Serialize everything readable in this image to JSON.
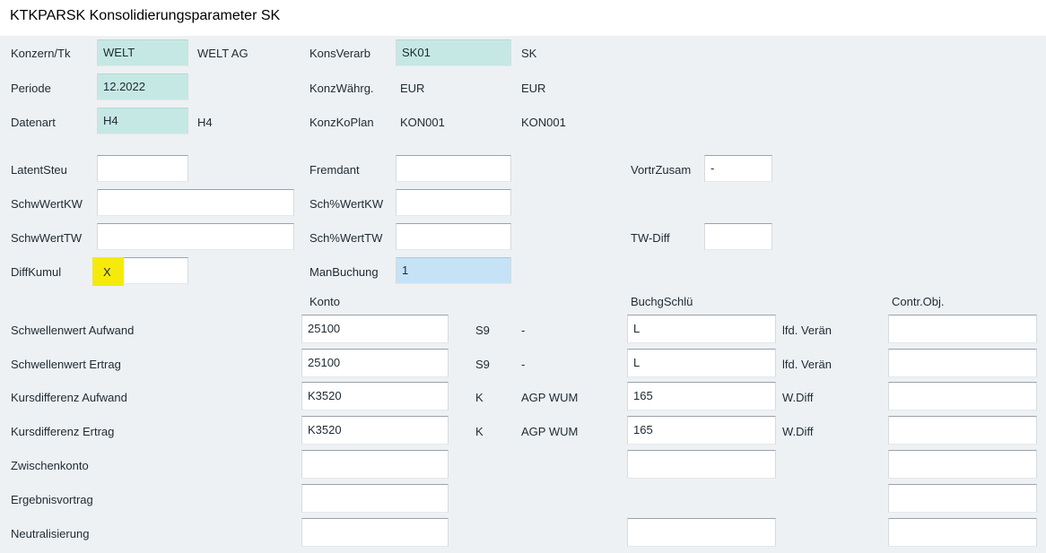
{
  "window": {
    "title": "KTKPARSK Konsolidierungsparameter SK"
  },
  "header": {
    "konzern_label": "Konzern/Tk",
    "konzern_value": "WELT",
    "konzern_text": "WELT AG",
    "periode_label": "Periode",
    "periode_value": "12.2022",
    "datenart_label": "Datenart",
    "datenart_value": "H4",
    "datenart_text": "H4",
    "konsverarb_label": "KonsVerarb",
    "konsverarb_value": "SK01",
    "konsverarb_text": "SK",
    "konzwaehrg_label": "KonzWährg.",
    "konzwaehrg_value": "EUR",
    "konzwaehrg_text": "EUR",
    "konzkoplan_label": "KonzKoPlan",
    "konzkoplan_value": "KON001",
    "konzkoplan_text": "KON001"
  },
  "params": {
    "latentsteu_label": "LatentSteu",
    "latentsteu_value": "",
    "schwwertkw_label": "SchwWertKW",
    "schwwertkw_value": "",
    "schwwerttw_label": "SchwWertTW",
    "schwwerttw_value": "",
    "diffkumul_label": "DiffKumul",
    "diffkumul_value": "X",
    "fremdant_label": "Fremdant",
    "fremdant_value": "",
    "schpwertkw_label": "Sch%WertKW",
    "schpwertkw_value": "",
    "schpwerttw_label": "Sch%WertTW",
    "schpwerttw_value": "",
    "manbuchung_label": "ManBuchung",
    "manbuchung_value": "1",
    "vortrzusam_label": "VortrZusam",
    "vortrzusam_value": "-",
    "twdiff_label": "TW-Diff",
    "twdiff_value": ""
  },
  "table": {
    "col_konto": "Konto",
    "col_buchgschl": "BuchgSchlü",
    "col_controbj": "Contr.Obj.",
    "rows": [
      {
        "label": "Schwellenwert Aufwand",
        "konto": "25100",
        "type": "S9",
        "desc": "-",
        "buchgschl": "L",
        "buchgtext": "lfd. Verän",
        "contr": ""
      },
      {
        "label": "Schwellenwert Ertrag",
        "konto": "25100",
        "type": "S9",
        "desc": "-",
        "buchgschl": "L",
        "buchgtext": "lfd. Verän",
        "contr": ""
      },
      {
        "label": "Kursdifferenz Aufwand",
        "konto": "K3520",
        "type": "K",
        "desc": "AGP WUM",
        "buchgschl": "165",
        "buchgtext": "W.Diff",
        "contr": ""
      },
      {
        "label": "Kursdifferenz Ertrag",
        "konto": "K3520",
        "type": "K",
        "desc": "AGP WUM",
        "buchgschl": "165",
        "buchgtext": "W.Diff",
        "contr": ""
      },
      {
        "label": "Zwischenkonto",
        "konto": "",
        "type": "",
        "desc": "",
        "buchgschl": "",
        "buchgtext": "",
        "contr": ""
      },
      {
        "label": "Ergebnisvortrag",
        "konto": "",
        "type": "",
        "desc": "",
        "buchgschl": "",
        "buchgtext": "",
        "contr": ""
      },
      {
        "label": "Neutralisierung",
        "konto": "",
        "type": "",
        "desc": "",
        "buchgschl": "",
        "buchgtext": "",
        "contr": ""
      }
    ]
  }
}
